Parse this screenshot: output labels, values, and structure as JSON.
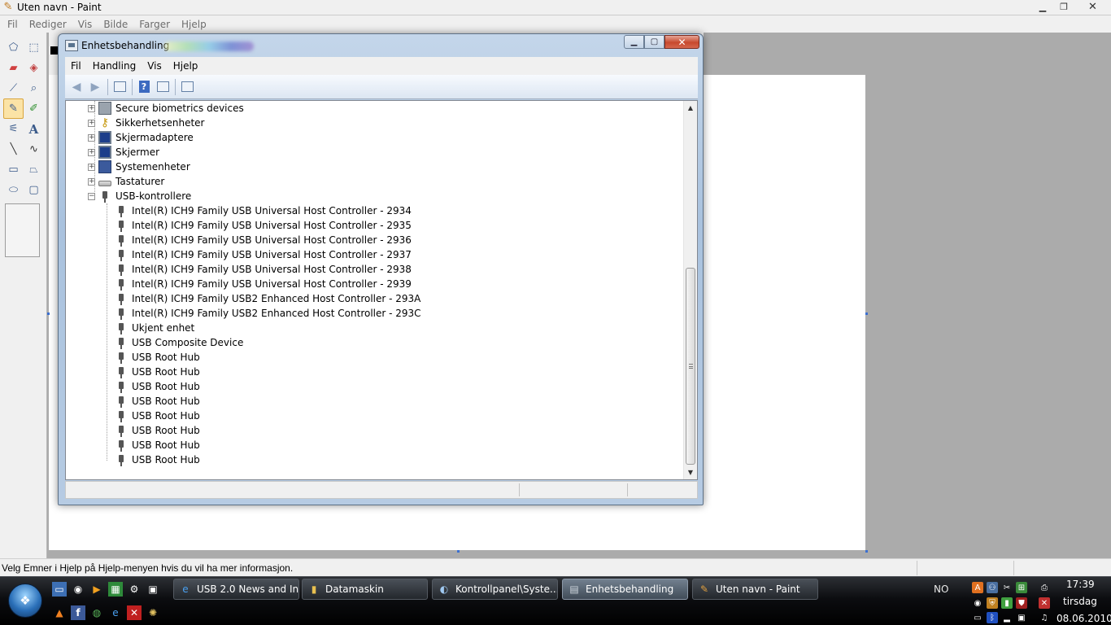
{
  "paint": {
    "title": "Uten navn - Paint",
    "menu": [
      "Fil",
      "Rediger",
      "Vis",
      "Bilde",
      "Farger",
      "Hjelp"
    ],
    "status": "Velg Emner i Hjelp på Hjelp-menyen hvis du vil ha mer informasjon."
  },
  "device_manager": {
    "title": "Enhetsbehandling",
    "menu": [
      "Fil",
      "Handling",
      "Vis",
      "Hjelp"
    ],
    "categories": [
      {
        "label": "Secure biometrics devices",
        "icon": "biometric-icon",
        "expanded": false
      },
      {
        "label": "Sikkerhetsenheter",
        "icon": "key-icon",
        "expanded": false
      },
      {
        "label": "Skjermadaptere",
        "icon": "display-adapter-icon",
        "expanded": false
      },
      {
        "label": "Skjermer",
        "icon": "monitor-icon",
        "expanded": false
      },
      {
        "label": "Systemenheter",
        "icon": "system-device-icon",
        "expanded": false
      },
      {
        "label": "Tastaturer",
        "icon": "keyboard-icon",
        "expanded": false
      },
      {
        "label": "USB-kontrollere",
        "icon": "usb-icon",
        "expanded": true
      }
    ],
    "usb_devices": [
      "Intel(R) ICH9 Family USB Universal Host Controller - 2934",
      "Intel(R) ICH9 Family USB Universal Host Controller - 2935",
      "Intel(R) ICH9 Family USB Universal Host Controller - 2936",
      "Intel(R) ICH9 Family USB Universal Host Controller - 2937",
      "Intel(R) ICH9 Family USB Universal Host Controller - 2938",
      "Intel(R) ICH9 Family USB Universal Host Controller - 2939",
      "Intel(R) ICH9 Family USB2 Enhanced Host Controller - 293A",
      "Intel(R) ICH9 Family USB2 Enhanced Host Controller - 293C",
      "Ukjent enhet",
      "USB Composite Device",
      "USB Root Hub",
      "USB Root Hub",
      "USB Root Hub",
      "USB Root Hub",
      "USB Root Hub",
      "USB Root Hub",
      "USB Root Hub",
      "USB Root Hub"
    ]
  },
  "taskbar": {
    "tasks": [
      {
        "label": "USB 2.0 News and In...",
        "icon": "internet-explorer-icon"
      },
      {
        "label": "Datamaskin",
        "icon": "folder-icon"
      },
      {
        "label": "Kontrollpanel\\Syste...",
        "icon": "control-panel-icon"
      },
      {
        "label": "Enhetsbehandling",
        "icon": "device-manager-icon",
        "active": true
      },
      {
        "label": "Uten navn - Paint",
        "icon": "paint-icon"
      }
    ],
    "language": "NO",
    "time": "17:39",
    "day": "tirsdag",
    "date": "08.06.2010"
  },
  "colors": {
    "canvas": "#ffffff",
    "workspace": "#ababab",
    "taskbar": "#0c0d10",
    "active_task": "#72808f"
  }
}
